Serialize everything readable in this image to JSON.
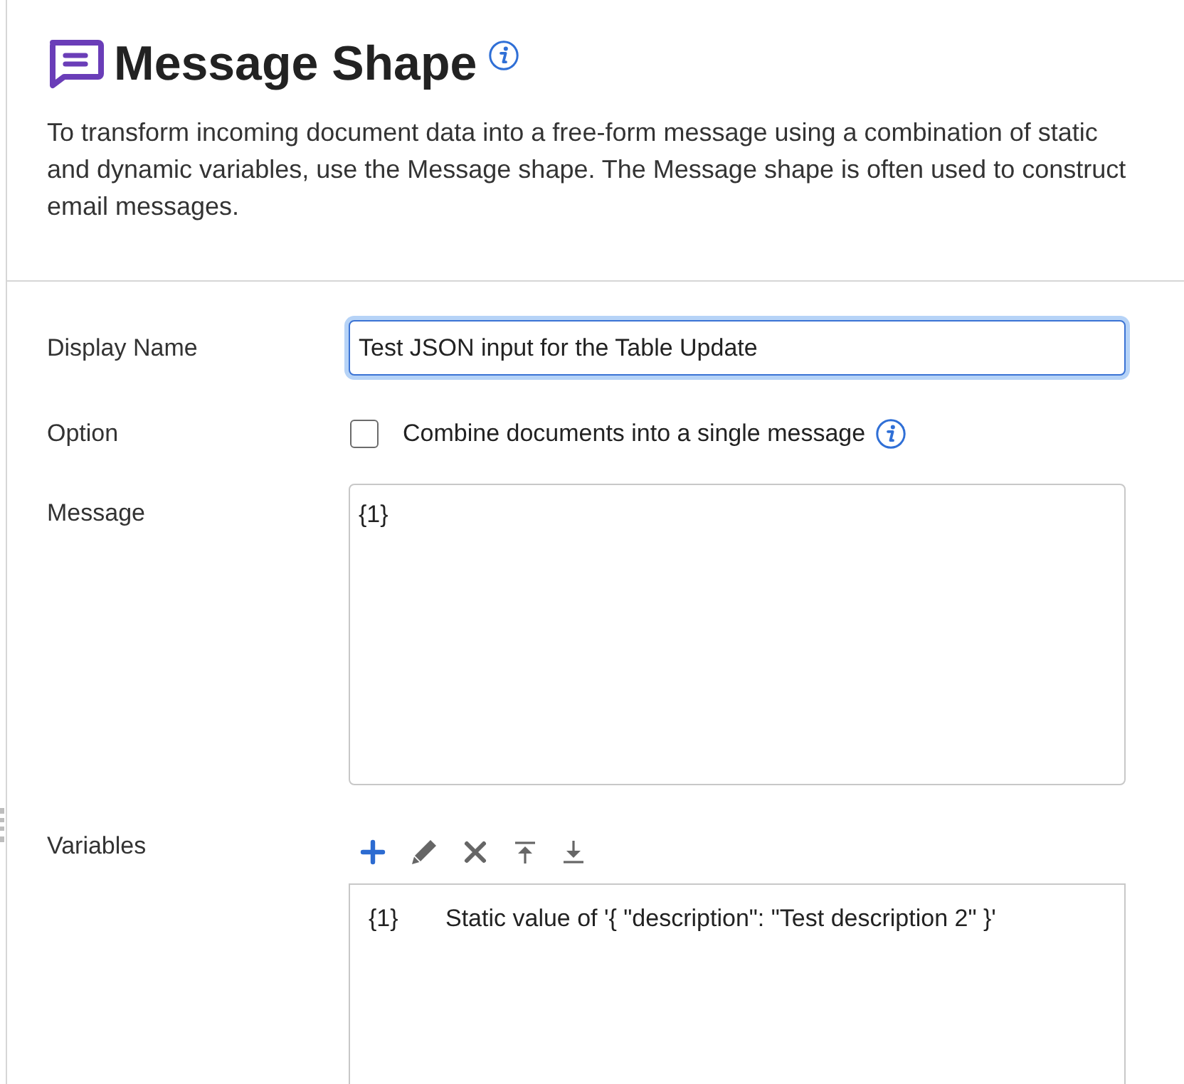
{
  "header": {
    "title": "Message Shape",
    "description": "To transform incoming document data into a free-form message using a combination of static and dynamic variables, use the Message shape. The Message shape is often used to construct email messages."
  },
  "fields": [
    {
      "kind": "text",
      "label": "Display Name",
      "value": "Test JSON input for the Table Update",
      "focused": true
    },
    {
      "kind": "checkbox",
      "label": "Option",
      "option_label": "Combine documents into a single message",
      "checked": false
    },
    {
      "kind": "textarea",
      "label": "Message",
      "value": "{1}"
    },
    {
      "kind": "list",
      "label": "Variables",
      "rows": [
        {
          "variable": "{1}",
          "value": "Static value of '{ \"description\": \"Test description 2\" }'",
          "selected": false
        }
      ]
    }
  ]
}
